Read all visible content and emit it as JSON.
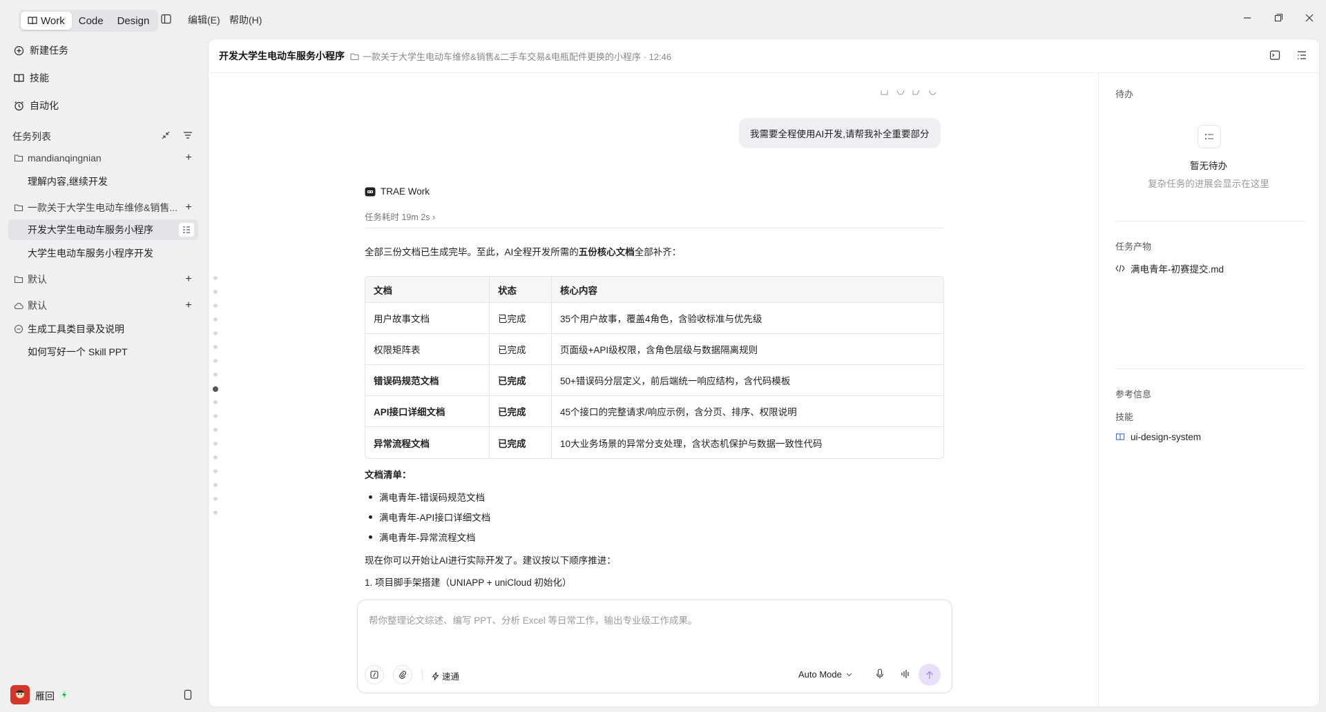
{
  "titlebar": {
    "modes": [
      "Work",
      "Code",
      "Design"
    ],
    "menus": [
      "编辑(E)",
      "帮助(H)"
    ]
  },
  "sidebar": {
    "new_task": "新建任务",
    "skills": "技能",
    "automation": "自动化",
    "task_list": "任务列表",
    "groups": [
      {
        "name": "mandianqingnian",
        "items": [
          "理解内容,继续开发"
        ]
      },
      {
        "name": "一款关于大学生电动车维修&销售...",
        "items": [
          "开发大学生电动车服务小程序",
          "大学生电动车服务小程序开发"
        ]
      },
      {
        "name": "默认",
        "items": []
      },
      {
        "name": "默认",
        "items": []
      },
      {
        "name": "生成工具类目录及说明",
        "items": [
          "如何写好一个 Skill PPT"
        ]
      }
    ],
    "user": "雁回"
  },
  "header": {
    "title": "开发大学生电动车服务小程序",
    "subtitle": "一款关于大学生电动车维修&销售&二手车交易&电瓶配件更换的小程序 · 12:46"
  },
  "chat": {
    "user_message": "我需要全程使用AI开发,请帮我补全重要部分",
    "bot_name": "TRAE Work",
    "elapsed": "任务耗时 19m 2s",
    "intro_pre": "全部三份文档已生成完毕。至此，AI全程开发所需的",
    "intro_bold": "五份核心文档",
    "intro_post": "全部补齐：",
    "table": {
      "headers": [
        "文档",
        "状态",
        "核心内容"
      ],
      "rows": [
        [
          "用户故事文档",
          "已完成",
          "35个用户故事，覆盖4角色，含验收标准与优先级"
        ],
        [
          "权限矩阵表",
          "已完成",
          "页面级+API级权限，含角色层级与数据隔离规则"
        ],
        [
          "错误码规范文档",
          "已完成",
          "50+错误码分层定义，前后端统一响应结构，含代码模板"
        ],
        [
          "API接口详细文档",
          "已完成",
          "45个接口的完整请求/响应示例，含分页、排序、权限说明"
        ],
        [
          "异常流程文档",
          "已完成",
          "10大业务场景的异常分支处理，含状态机保护与数据一致性代码"
        ]
      ]
    },
    "list_title": "文档清单：",
    "docs": [
      "满电青年-错误码规范文档",
      "满电青年-API接口详细文档",
      "满电青年-异常流程文档"
    ],
    "next_text": "现在你可以开始让AI进行实际开发了。建议按以下顺序推进：",
    "step1": "1. 项目脚手架搭建（UNIAPP + uniCloud 初始化）"
  },
  "composer": {
    "placeholder": "帮你整理论文综述、编写 PPT、分析 Excel 等日常工作，输出专业级工作成果。",
    "speed": "速通",
    "mode": "Auto Mode"
  },
  "right": {
    "todo_title": "待办",
    "todo_empty": "暂无待办",
    "todo_hint": "复杂任务的进展会显示在这里",
    "artifacts_title": "任务产物",
    "artifact": "满电青年-初赛提交.md",
    "ref_title": "参考信息",
    "skills_title": "技能",
    "skill": "ui-design-system"
  }
}
